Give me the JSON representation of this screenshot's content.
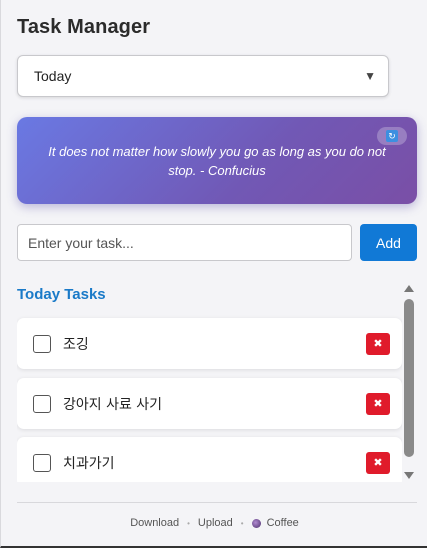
{
  "app": {
    "title": "Task Manager"
  },
  "filter": {
    "selected": "Today",
    "caret": "▼"
  },
  "quote": {
    "text": "It does not matter how slowly you go as long as you do not stop. - Confucius",
    "refresh_icon": "refresh-icon"
  },
  "new_task": {
    "placeholder": "Enter your task...",
    "value": "",
    "add_label": "Add"
  },
  "section": {
    "title": "Today Tasks"
  },
  "tasks": [
    {
      "label": "조깅",
      "done": false,
      "delete_label": "✖"
    },
    {
      "label": "강아지 사료 사기",
      "done": false,
      "delete_label": "✖"
    },
    {
      "label": "치과가기",
      "done": false,
      "delete_label": "✖"
    }
  ],
  "footer": {
    "download": "Download",
    "upload": "Upload",
    "coffee": "Coffee",
    "separator": "•"
  },
  "colors": {
    "accent": "#1179d6",
    "delete": "#e01b2b",
    "quote_start": "#6a79e3",
    "quote_end": "#7a4fa6",
    "section_title": "#1a7ac8"
  }
}
